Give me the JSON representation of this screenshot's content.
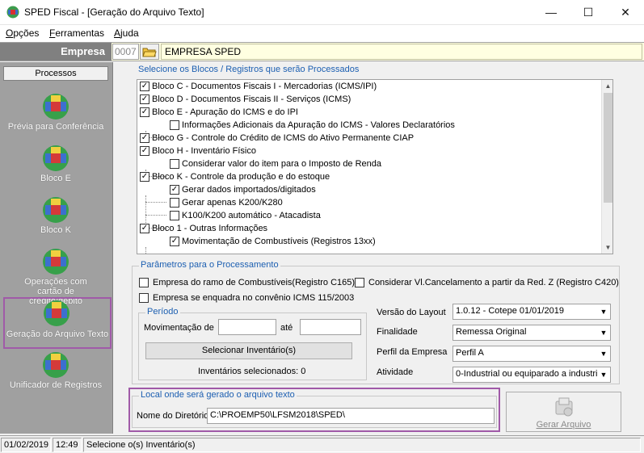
{
  "window": {
    "title": "SPED Fiscal - [Geração do Arquivo Texto]",
    "minimize": "—",
    "maximize": "☐",
    "close": "✕"
  },
  "menu": [
    {
      "label_ul": "O",
      "label_rest": "pções"
    },
    {
      "label_ul": "F",
      "label_rest": "erramentas"
    },
    {
      "label_ul": "A",
      "label_rest": "juda"
    }
  ],
  "empresa": {
    "label": "Empresa",
    "code": "0007",
    "name": "EMPRESA SPED"
  },
  "sidebar": {
    "header": "Processos",
    "items": [
      {
        "label": "Prévia para Conferência"
      },
      {
        "label": "Bloco E"
      },
      {
        "label": "Bloco K"
      },
      {
        "label": "Operações com cartão de crédito/débito"
      },
      {
        "label": "Geração do Arquivo Texto"
      },
      {
        "label": "Unificador de Registros"
      }
    ]
  },
  "blocos": {
    "title": "Selecione os Blocos / Registros que serão Processados",
    "items": [
      {
        "label": "Bloco C - Documentos Fiscais I - Mercadorias (ICMS/IPI)",
        "checked": true,
        "level": 0
      },
      {
        "label": "Bloco D - Documentos Fiscais II - Serviços (ICMS)",
        "checked": true,
        "level": 0
      },
      {
        "label": "Bloco E - Apuração do ICMS e do IPI",
        "checked": true,
        "level": 0
      },
      {
        "label": "Informações Adicionais da Apuração do ICMS - Valores Declaratórios",
        "checked": false,
        "level": 1
      },
      {
        "label": "Bloco G - Controle do Crédito de ICMS do Ativo Permanente CIAP",
        "checked": true,
        "level": 0
      },
      {
        "label": "Bloco H - Inventário Físico",
        "checked": true,
        "level": 0
      },
      {
        "label": "Considerar valor do item para o Imposto de Renda",
        "checked": false,
        "level": 1
      },
      {
        "label": "Bloco K - Controle da produção e do estoque",
        "checked": true,
        "level": 0
      },
      {
        "label": "Gerar dados importados/digitados",
        "checked": true,
        "level": 1
      },
      {
        "label": "Gerar apenas K200/K280",
        "checked": false,
        "level": 1
      },
      {
        "label": "K100/K200 automático - Atacadista",
        "checked": false,
        "level": 1
      },
      {
        "label": "Bloco 1 - Outras Informações",
        "checked": true,
        "level": 0
      },
      {
        "label": "Movimentação de Combustíveis (Registros 13xx)",
        "checked": true,
        "level": 1
      }
    ]
  },
  "parametros": {
    "title": "Parâmetros para o Processamento",
    "combustiveis": {
      "label": "Empresa do ramo de Combustíveis(Registro C165)",
      "checked": false
    },
    "cancelamento": {
      "label": "Considerar Vl.Cancelamento a partir da Red. Z (Registro C420)",
      "checked": false
    },
    "convenio": {
      "label": "Empresa se enquadra no convênio ICMS 115/2003",
      "checked": false
    }
  },
  "periodo": {
    "title": "Período",
    "movimentacao_label": "Movimentação de",
    "ate_label": "até",
    "from_value": "",
    "to_value": "",
    "inventario_button": "Selecionar Inventário(s)",
    "inventarios_text": "Inventários selecionados: 0"
  },
  "fields": {
    "versao_label": "Versão do Layout",
    "versao_value": "1.0.12 - Cotepe 01/01/2019",
    "finalidade_label": "Finalidade",
    "finalidade_value": "Remessa Original",
    "perfil_label": "Perfil da Empresa",
    "perfil_value": "Perfil A",
    "atividade_label": "Atividade",
    "atividade_value": "0-Industrial ou equiparado a industrial"
  },
  "local": {
    "title": "Local onde será gerado o arquivo texto",
    "diretorio_label": "Nome do Diretório",
    "diretorio_value": "C:\\PROEMP50\\LFSM2018\\SPED\\"
  },
  "gerar_button": "Gerar Arquivo",
  "status": {
    "date": "01/02/2019",
    "time": "12:49",
    "message": "Selecione o(s) Inventário(s)"
  },
  "colors": {
    "highlight": "#a05aa8",
    "group_title": "#1c5fb1",
    "sidebar_bg": "#a0a0a0",
    "empresa_bg": "#ffffe1"
  }
}
